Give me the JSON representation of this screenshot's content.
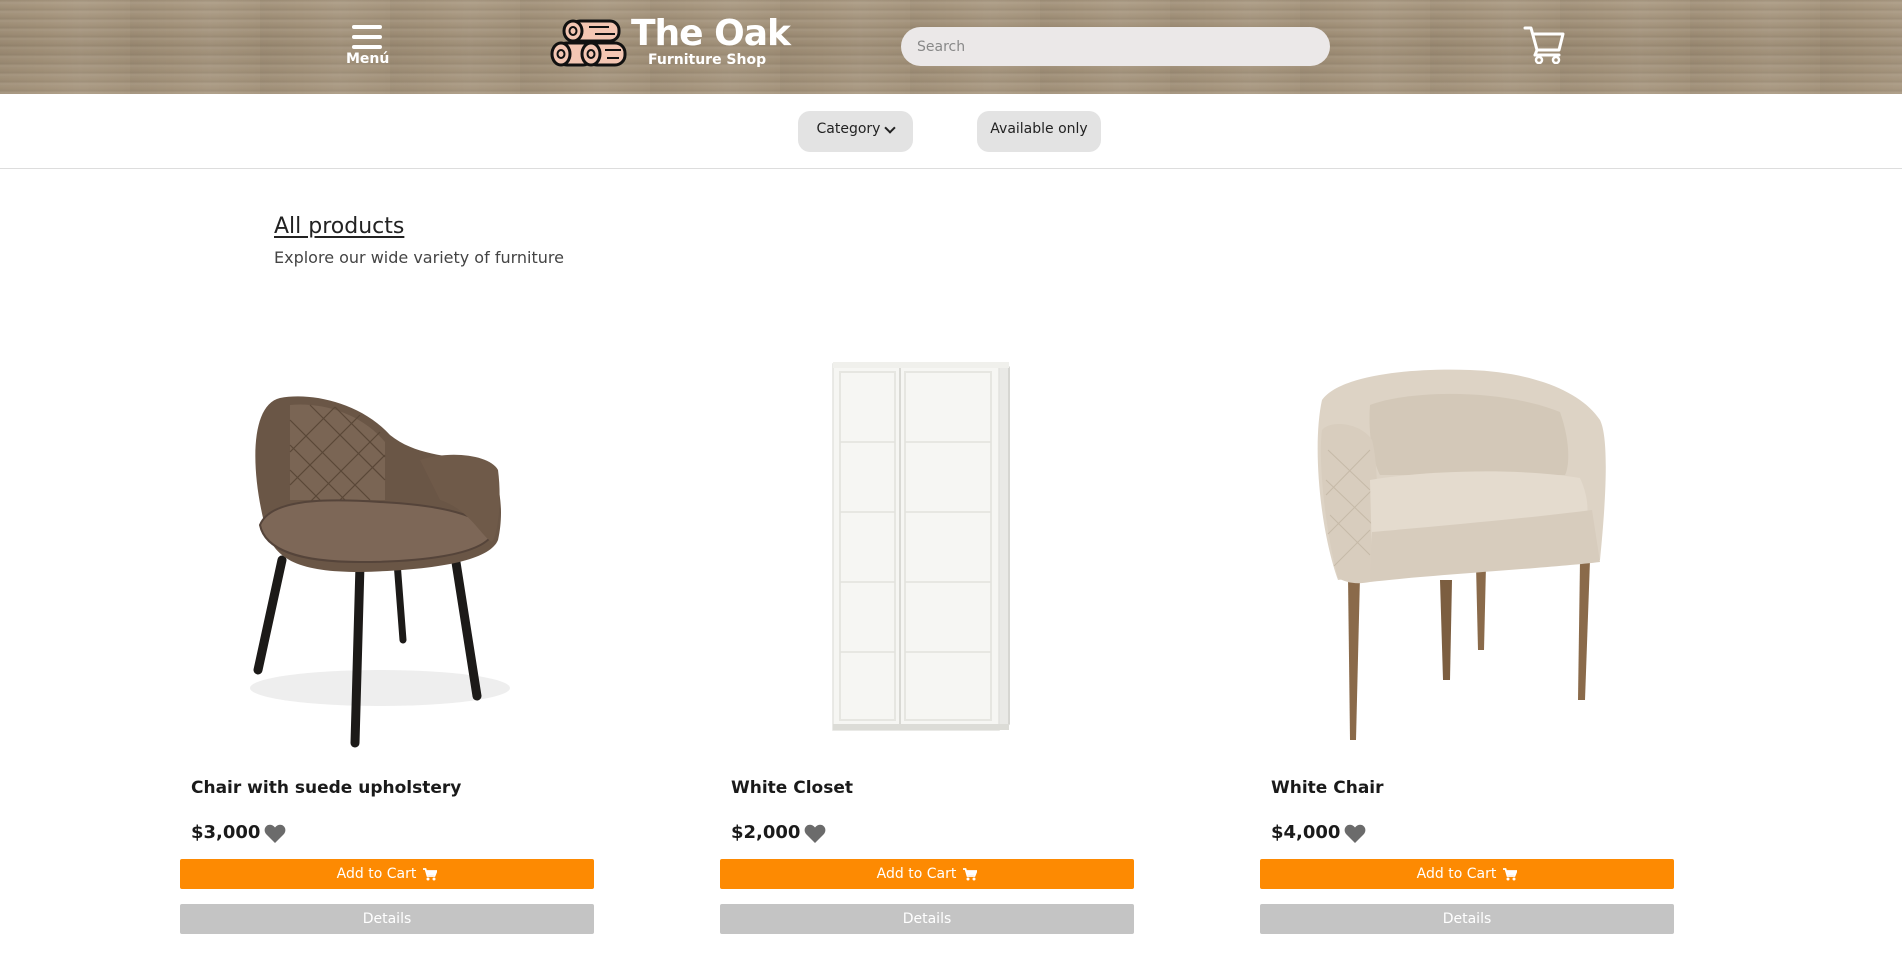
{
  "header": {
    "menu_label": "Menú",
    "logo_title": "The Oak",
    "logo_subtitle": "Furniture Shop",
    "search_placeholder": "Search",
    "icons": {
      "menu": "hamburger-icon",
      "logo": "logs-icon",
      "cart": "cart-icon"
    }
  },
  "filters": {
    "category_label": "Category",
    "available_label": "Available only"
  },
  "section": {
    "title": "All products",
    "subtitle": "Explore our wide variety of furniture"
  },
  "colors": {
    "accent": "#fd8a02",
    "details_button": "#c4c4c4",
    "header_wood": "#a08f78",
    "chip_bg": "#e3e3e3"
  },
  "products": [
    {
      "name": "Chair with suede upholstery",
      "price": "$3,000",
      "add_label": "Add to Cart",
      "details_label": "Details",
      "image": "brown-suede-chair"
    },
    {
      "name": "White Closet",
      "price": "$2,000",
      "add_label": "Add to Cart",
      "details_label": "Details",
      "image": "white-wardrobe"
    },
    {
      "name": "White Chair",
      "price": "$4,000",
      "add_label": "Add to Cart",
      "details_label": "Details",
      "image": "beige-armchair"
    }
  ]
}
